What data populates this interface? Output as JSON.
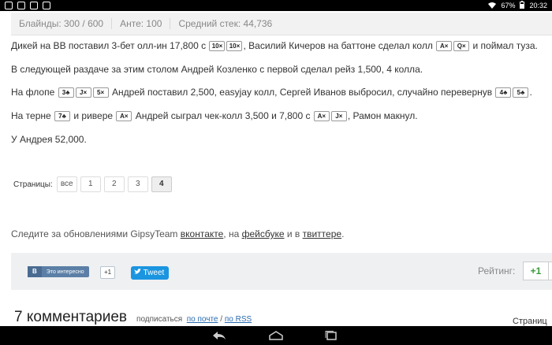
{
  "status_bar": {
    "battery": "67%",
    "time": "20:32"
  },
  "info": {
    "blinds": "Блайнды: 300 / 600",
    "ante": "Анте: 100",
    "avg_stack": "Средний стек: 44,736"
  },
  "paragraphs": {
    "p1": {
      "t1": "Дикей на ВВ поставил 3-бет олл-ин 17,800 с ",
      "c1": "10",
      "c2": "10",
      "t2": ", Василий Кичеров на баттоне сделал колл ",
      "c3": "A",
      "c4": "Q",
      "t3": " и поймал туза."
    },
    "p2": {
      "t1": "В следующей раздаче за этим столом Андрей Козленко с первой сделал рейз 1,500, 4 колла."
    },
    "p3": {
      "t1": "На флопе ",
      "c1": "3",
      "c2": "J",
      "c3": "5",
      "t2": " Андрей поставил 2,500, easyjay колл, Сергей Иванов выбросил, случайно перевернув ",
      "c4": "4",
      "c5": "5",
      "t3": "."
    },
    "p4": {
      "t1": "На терне ",
      "c1": "7",
      "t2": " и ривере ",
      "c2": "A",
      "t3": " Андрей сыграл чек-колл 3,500 и 7,800 с ",
      "c3": "A",
      "c4": "J",
      "t4": ", Рамон макнул."
    },
    "p5": {
      "t1": "У Андрея 52,000."
    }
  },
  "pagination": {
    "label": "Страницы:",
    "items": [
      "все",
      "1",
      "2",
      "3",
      "4"
    ],
    "active": "4"
  },
  "follow": {
    "t1": "Следите за обновлениями GipsyTeam ",
    "l1": "вконтакте",
    "t2": ", на ",
    "l2": "фейсбуке",
    "t3": " и в ",
    "l3": "твиттере",
    "t4": "."
  },
  "social": {
    "vk_logo": "В",
    "vk_label": "Это интересно",
    "vk_count": "+1",
    "tweet_label": "Tweet",
    "rating_label": "Рейтинг:",
    "rating_value": "+1"
  },
  "comments": {
    "title": "7 комментариев",
    "subscribe": "подписаться",
    "by_mail": "по почте",
    "sep": "/",
    "by_rss": "по RSS",
    "pages_right": "Страниц"
  }
}
